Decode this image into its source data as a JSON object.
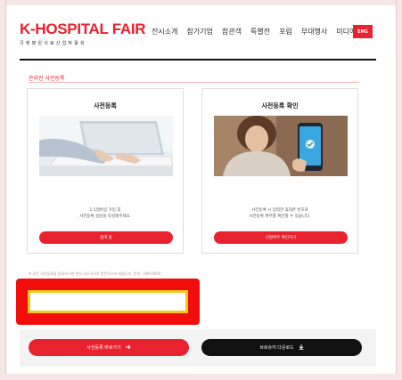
{
  "logo": {
    "title": "K-HOSPITAL FAIR",
    "subtitle": "국제병원의료산업박람회"
  },
  "nav": {
    "items": [
      "전시소개",
      "참가기업",
      "참관객",
      "특별전",
      "포럼",
      "부대행사",
      "미디어"
    ],
    "lang_button": "ENG"
  },
  "section": {
    "title": "온라인 사전등록"
  },
  "cards": [
    {
      "title": "사전등록",
      "desc": [
        "1:1멤버십 가입 후",
        "사전등록 설문을 작성해주세요."
      ],
      "button": "참여 중"
    },
    {
      "title": "사전등록 확인",
      "desc": [
        "사전등록 시 입력한 휴대폰 번호로",
        "사전등록 여부를 확인할 수 있습니다."
      ],
      "button": "신청여부 확인하기"
    }
  ],
  "notice": "※ 모든 사전등록을 완료하시면 본사 사무국으로 방문하시기 바랍니다. 문의 : 000-0000",
  "bottom": {
    "register_label": "사전등록 바로가기",
    "brochure_label": "브로슈어 다운로드"
  },
  "colors": {
    "brand_red": "#e8222e",
    "highlight_red": "#f20d0d",
    "highlight_yellow": "#f5c518"
  },
  "icons": {
    "arrow": "arrow-right-icon",
    "download": "download-icon"
  }
}
